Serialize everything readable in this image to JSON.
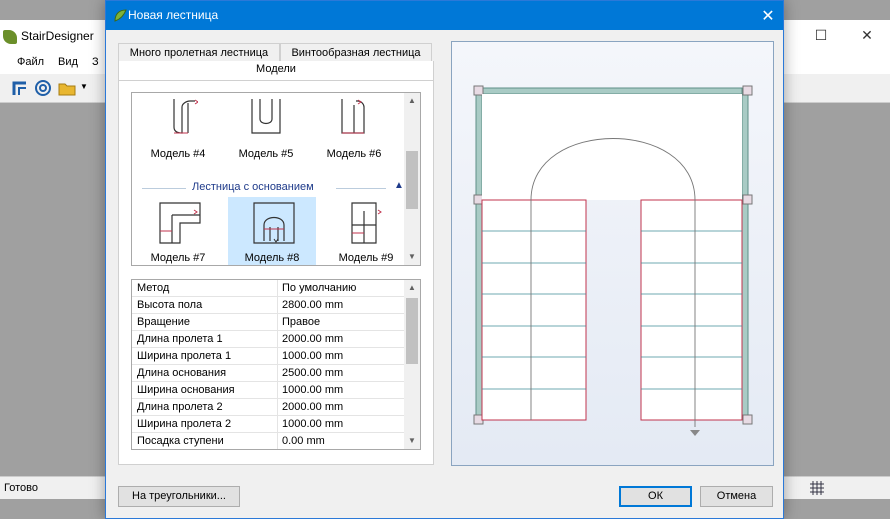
{
  "background_app": {
    "title": "StairDesigner",
    "menu": [
      "Файл",
      "Вид",
      "З"
    ],
    "status": "Готово"
  },
  "dialog": {
    "title": "Новая лестница",
    "tabs": [
      {
        "label": "Много пролетная лестница"
      },
      {
        "label": "Винтообразная лестница"
      }
    ],
    "active_subtab": "Модели",
    "gallery": {
      "models_top": [
        {
          "label": "Модель #4"
        },
        {
          "label": "Модель #5"
        },
        {
          "label": "Модель #6"
        }
      ],
      "group_title": "Лестница с основанием",
      "models_bottom": [
        {
          "label": "Модель #7"
        },
        {
          "label": "Модель #8",
          "selected": true
        },
        {
          "label": "Модель #9"
        }
      ]
    },
    "properties": [
      {
        "key": "Метод",
        "value": "По умолчанию"
      },
      {
        "key": "Высота пола",
        "value": "2800.00 mm"
      },
      {
        "key": "Вращение",
        "value": "Правое"
      },
      {
        "key": "Длина пролета 1",
        "value": "2000.00 mm"
      },
      {
        "key": "Ширина пролета 1",
        "value": "1000.00 mm"
      },
      {
        "key": "Длина основания",
        "value": "2500.00 mm"
      },
      {
        "key": "Ширина основания",
        "value": "1000.00 mm"
      },
      {
        "key": "Длина пролета 2",
        "value": "2000.00 mm"
      },
      {
        "key": "Ширина пролета 2",
        "value": "1000.00 mm"
      },
      {
        "key": "Посадка ступени",
        "value": "0.00 mm"
      }
    ],
    "buttons": {
      "triangles": "На треугольники...",
      "ok": "ОК",
      "cancel": "Отмена"
    }
  },
  "colors": {
    "titlebar": "#0078d7",
    "selection": "#cce8ff",
    "wall": "#8fb5ad",
    "stringer_red": "#c0334d",
    "tread_teal": "#3f8e97"
  }
}
